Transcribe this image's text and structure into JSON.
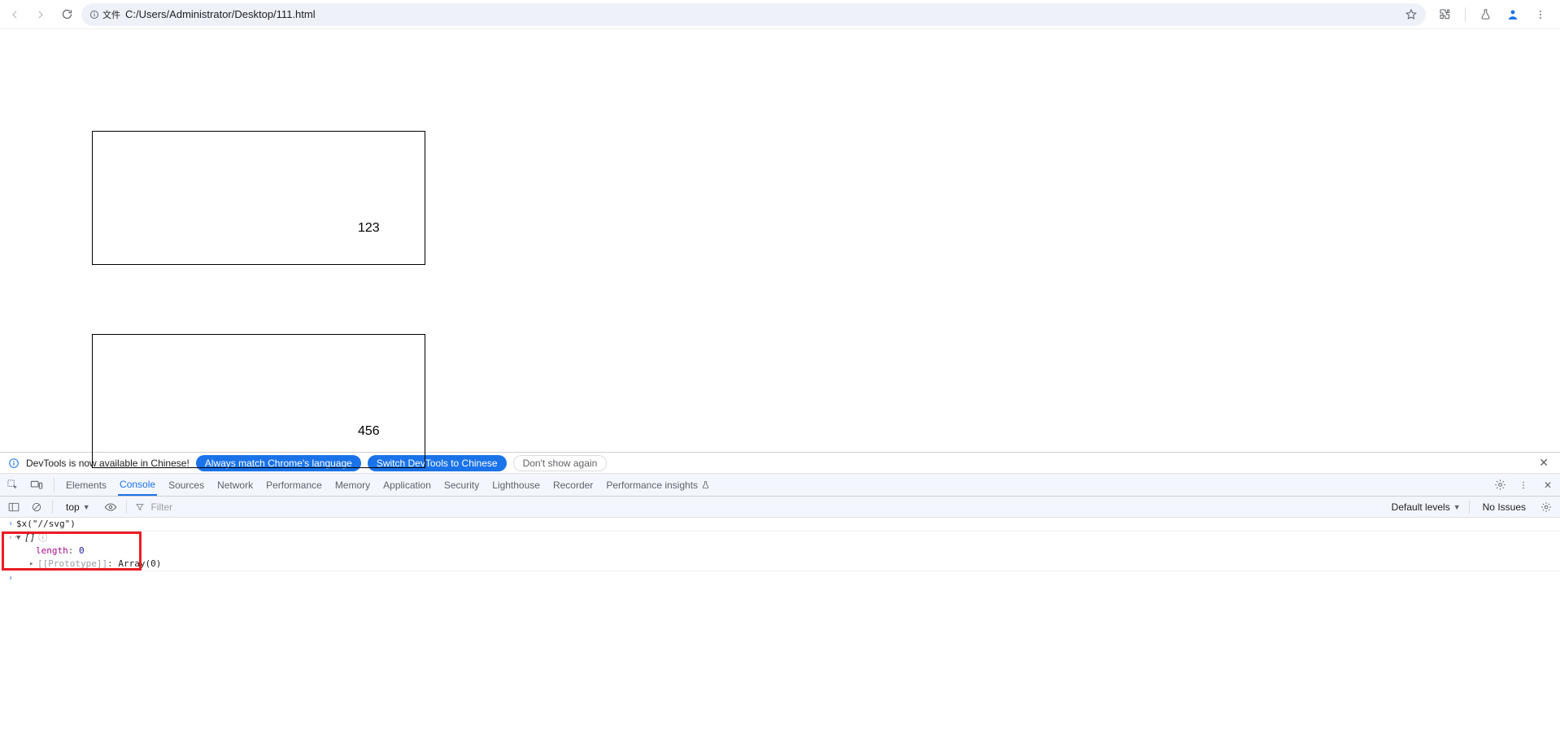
{
  "browser": {
    "url": "C:/Users/Administrator/Desktop/111.html",
    "file_chip": "文件"
  },
  "page": {
    "box1_text": "123",
    "box2_text": "456"
  },
  "devtools": {
    "banner": {
      "text": "DevTools is now available in Chinese!",
      "btn_match": "Always match Chrome's language",
      "btn_switch": "Switch DevTools to Chinese",
      "btn_dont": "Don't show again"
    },
    "tabs": {
      "elements": "Elements",
      "console": "Console",
      "sources": "Sources",
      "network": "Network",
      "performance": "Performance",
      "memory": "Memory",
      "application": "Application",
      "security": "Security",
      "lighthouse": "Lighthouse",
      "recorder": "Recorder",
      "perf_insights": "Performance insights"
    },
    "console_toolbar": {
      "context": "top",
      "filter_placeholder": "Filter",
      "levels": "Default levels",
      "no_issues": "No Issues"
    },
    "console": {
      "input_cmd": "$x(\"//svg\")",
      "ret_brackets": "[]",
      "length_key": "length",
      "length_val": "0",
      "proto_key": "[[Prototype]]",
      "proto_val": "Array(0)"
    }
  }
}
